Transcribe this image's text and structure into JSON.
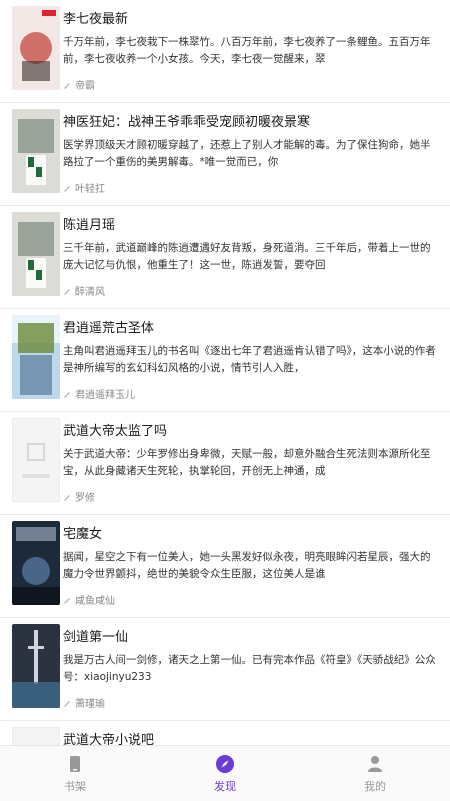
{
  "books": [
    {
      "title": "李七夜最新",
      "desc": "千万年前，李七夜栽下一株翠竹。八百万年前，李七夜养了一条鲤鱼。五百万年前，李七夜收养一个小女孩。今天，李七夜一觉醒来，翠",
      "author": "帝霸",
      "cover": "red"
    },
    {
      "title": "神医狂妃：战神王爷乖乖受宠顾初暖夜景寒",
      "desc": "医学界顶级天才顾初暖穿越了，还惹上了别人才能解的毒。为了保住狗命，她半路拉了一个重伤的美男解毒。*唯一觉而已，你",
      "author": "叶轻扛",
      "cover": "tower"
    },
    {
      "title": "陈逍月瑶",
      "desc": "三千年前，武道巅峰的陈逍遭遇好友背叛，身死道消。三千年后，带着上一世的庞大记忆与仇恨，他重生了！这一世，陈逍发誓，要夺回",
      "author": "醉清风",
      "cover": "tower"
    },
    {
      "title": "君逍遥荒古圣体",
      "desc": "主角叫君逍遥拜玉儿的书名叫《逐出七年了君逍遥肯认错了吗》，这本小说的作者是神所编写的玄幻科幻风格的小说，情节引人入胜，",
      "author": "君逍遥拜玉儿",
      "cover": "blue"
    },
    {
      "title": "武道大帝太监了吗",
      "desc": "关于武道大帝：少年罗修出身卑微，天赋一般，却意外融合生死法则本源所化至宝，从此身藏诸天生死轮，执掌轮回，开创无上神通，成",
      "author": "罗修",
      "cover": "blank"
    },
    {
      "title": "宅魔女",
      "desc": "据闻，星空之下有一位美人，她一头黑发好似永夜，明亮眼眸闪若星辰，强大的魔力令世界颤抖，绝世的美貌令众生臣服，这位美人是谁",
      "author": "咸鱼咸仙",
      "cover": "dark"
    },
    {
      "title": "剑道第一仙",
      "desc": "我是万古人间一剑修，诸天之上第一仙。已有完本作品《符皇》《天骄战纪》公众号：xiaojinyu233",
      "author": "萧瑾瑜",
      "cover": "sword"
    },
    {
      "title": "武道大帝小说吧",
      "desc": "",
      "author": "",
      "cover": "blank"
    }
  ],
  "tabs": [
    {
      "label": "书架",
      "icon": "phone-icon"
    },
    {
      "label": "发现",
      "icon": "compass-icon"
    },
    {
      "label": "我的",
      "icon": "user-icon"
    }
  ],
  "colors": {
    "accent": "#6b3bd6",
    "inactive": "#999999"
  }
}
